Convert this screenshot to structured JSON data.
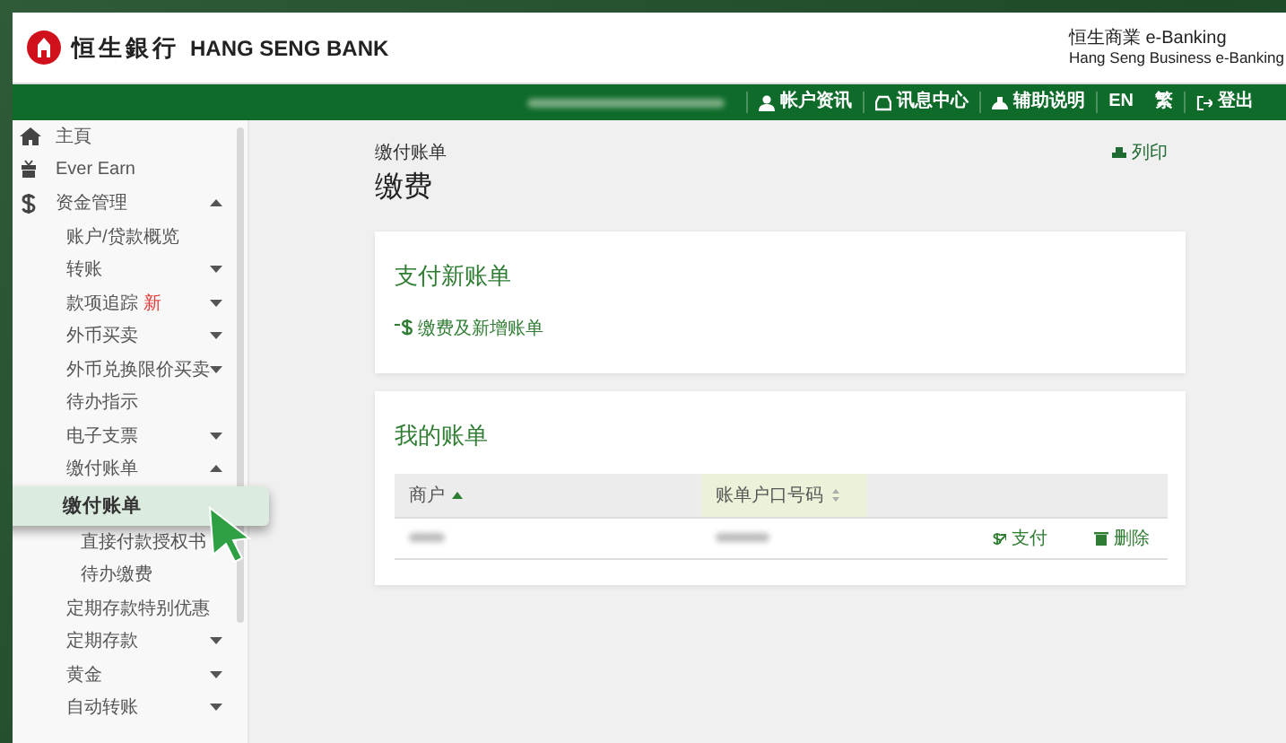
{
  "header": {
    "logo_chinese": "恒生銀行",
    "logo_english": "HANG SENG BANK",
    "service_chinese": "恒生商業 e-Banking",
    "service_english": "Hang Seng Business e-Banking"
  },
  "nav": [
    {
      "kind": "user",
      "label": "帐户资讯"
    },
    {
      "kind": "inbox",
      "label": "讯息中心"
    },
    {
      "kind": "help",
      "label": "辅助说明"
    },
    {
      "kind": "plain",
      "label": "EN"
    },
    {
      "kind": "plain",
      "label": "繁"
    },
    {
      "kind": "logout",
      "label": "登出"
    }
  ],
  "sidebar": {
    "items": [
      {
        "label": "主頁"
      },
      {
        "label": "Ever Earn"
      },
      {
        "label": "资金管理",
        "expanded": true,
        "children": [
          {
            "label": "账户/贷款概览"
          },
          {
            "label": "转账",
            "expanded": false
          },
          {
            "label": "款项追踪",
            "badge": "新",
            "expanded": false
          },
          {
            "label": "外币买卖",
            "expanded": false
          },
          {
            "label": "外币兑换限价买卖",
            "expanded": false
          },
          {
            "label": "待办指示"
          },
          {
            "label": "电子支票",
            "expanded": false
          },
          {
            "label": "缴付账单",
            "expanded": true,
            "children": [
              {
                "label": "缴付账单",
                "selected": true
              },
              {
                "label": "直接付款授权书",
                "selected": false
              },
              {
                "label": "待办缴费",
                "selected": false
              }
            ]
          },
          {
            "label": "定期存款特别优惠"
          },
          {
            "label": "定期存款",
            "expanded": false
          },
          {
            "label": "黄金",
            "expanded": false
          },
          {
            "label": "自动转账",
            "expanded": false
          }
        ]
      }
    ]
  },
  "page": {
    "breadcrumb": "缴付账单",
    "title": "缴费",
    "print": "列印"
  },
  "new_bill": {
    "title": "支付新账单",
    "link": "缴费及新增账单"
  },
  "my_bills": {
    "title": "我的账单",
    "columns": [
      {
        "label": "商户",
        "sorted": true,
        "highlighted": false
      },
      {
        "label": "账单户口号码",
        "sorted": false,
        "highlighted": true
      }
    ],
    "rows": [
      {
        "actions": [
          {
            "kind": "pay",
            "label": "支付"
          },
          {
            "kind": "delete",
            "label": "删除"
          }
        ]
      }
    ]
  }
}
